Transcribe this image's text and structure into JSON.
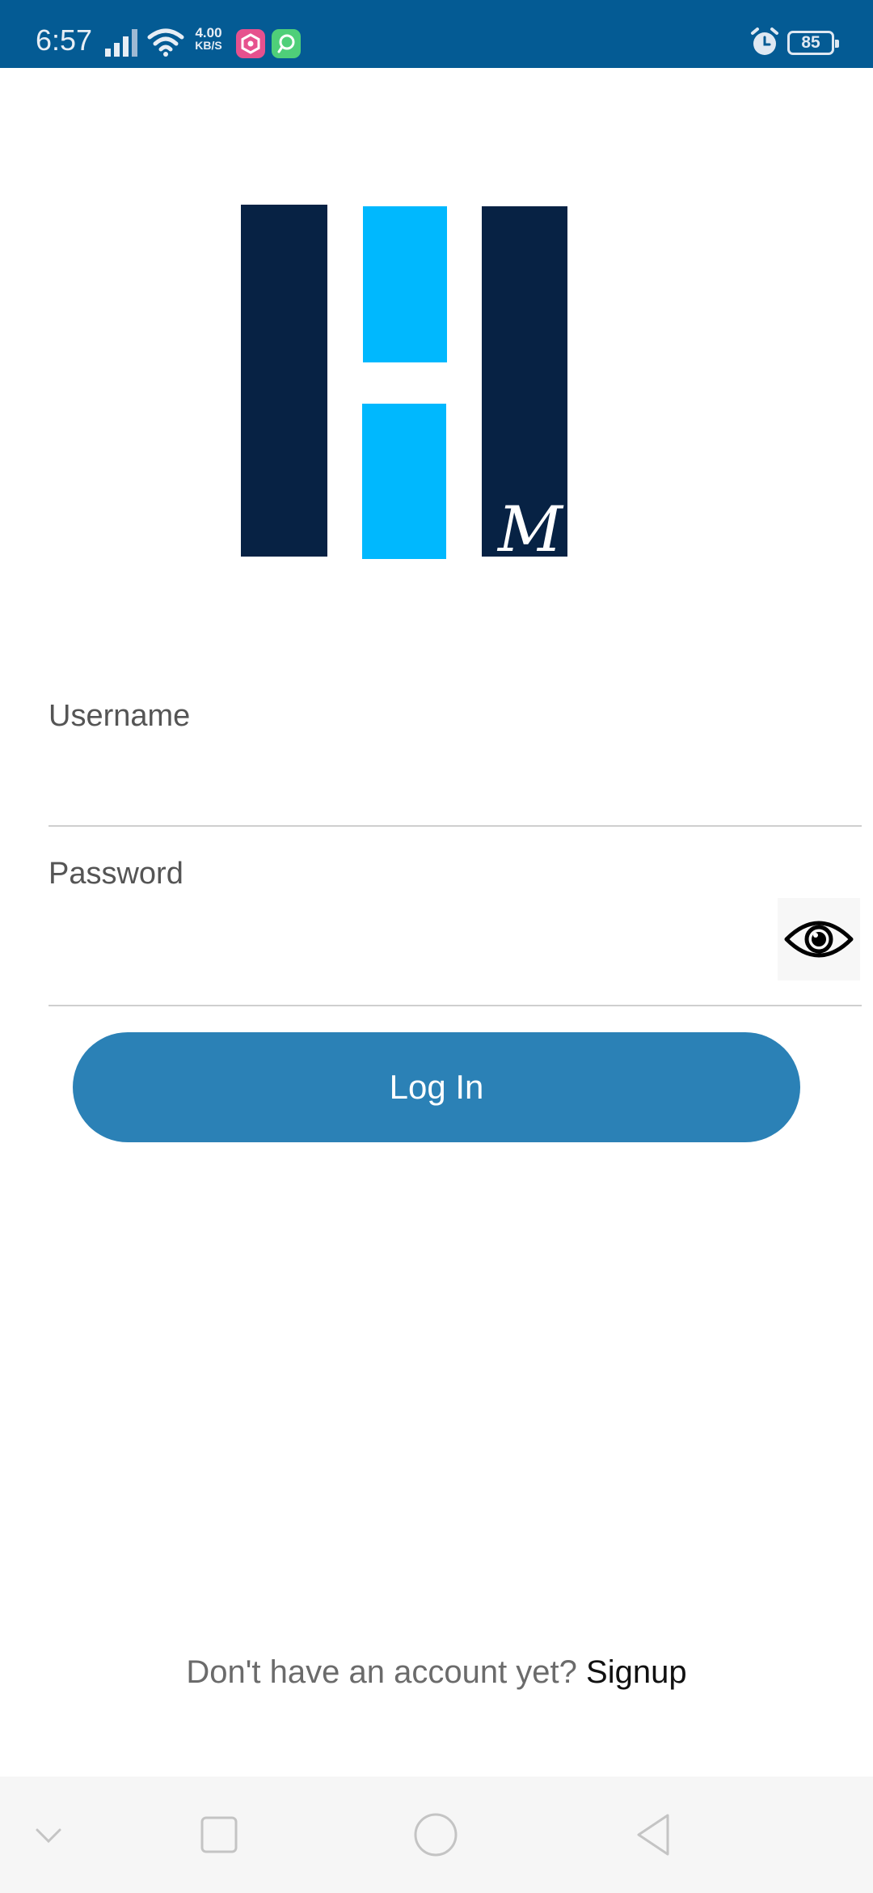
{
  "status_bar": {
    "time": "6:57",
    "net_speed_value": "4.00",
    "net_speed_unit": "KB/S",
    "battery": "85",
    "icons": [
      "signal-icon",
      "wifi-icon",
      "app-notification-icon",
      "app-notification-icon",
      "alarm-icon",
      "battery-icon"
    ],
    "background_color": "#045b94"
  },
  "logo": {
    "signature_text": "M",
    "colors": {
      "dark": "#072244",
      "accent": "#00b8fe"
    }
  },
  "form": {
    "username_label": "Username",
    "username_value": "",
    "password_label": "Password",
    "password_value": "",
    "toggle_icon": "eye-icon"
  },
  "login_button": {
    "label": "Log In",
    "color": "#2b81b6"
  },
  "signup": {
    "prompt": "Don't have an account yet? ",
    "link": "Signup"
  },
  "nav_bar": {
    "icons": [
      "chevron-down-icon",
      "recents-square-icon",
      "home-circle-icon",
      "back-triangle-icon"
    ]
  }
}
